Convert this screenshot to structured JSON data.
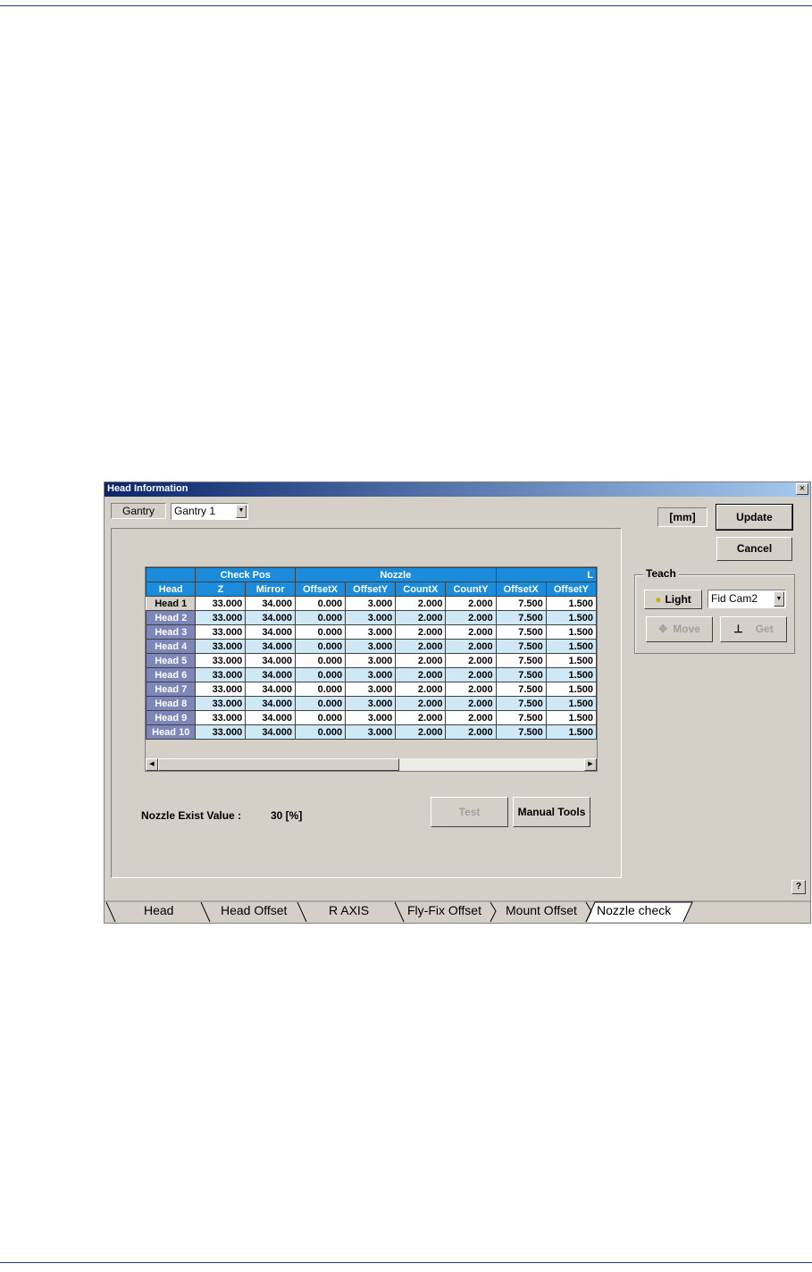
{
  "dialog": {
    "title": "Head Information",
    "close_glyph": "×",
    "gantry_label": "Gantry",
    "gantry_value": "Gantry 1",
    "unit": "[mm]",
    "update_label": "Update",
    "cancel_label": "Cancel",
    "help_glyph": "?"
  },
  "teach": {
    "legend": "Teach",
    "light_label": "Light",
    "camera_value": "Fid Cam2",
    "move_label": "Move",
    "get_label": "Get"
  },
  "grid": {
    "group_headers": [
      "Check Pos",
      "Nozzle",
      "L"
    ],
    "columns": [
      "Head",
      "Z",
      "Mirror",
      "OffsetX",
      "OffsetY",
      "CountX",
      "CountY",
      "OffsetX",
      "OffsetY"
    ],
    "rows": [
      {
        "head": "Head 1",
        "cells": [
          "33.000",
          "34.000",
          "0.000",
          "3.000",
          "2.000",
          "2.000",
          "7.500",
          "1.500"
        ]
      },
      {
        "head": "Head 2",
        "cells": [
          "33.000",
          "34.000",
          "0.000",
          "3.000",
          "2.000",
          "2.000",
          "7.500",
          "1.500"
        ]
      },
      {
        "head": "Head 3",
        "cells": [
          "33.000",
          "34.000",
          "0.000",
          "3.000",
          "2.000",
          "2.000",
          "7.500",
          "1.500"
        ]
      },
      {
        "head": "Head 4",
        "cells": [
          "33.000",
          "34.000",
          "0.000",
          "3.000",
          "2.000",
          "2.000",
          "7.500",
          "1.500"
        ]
      },
      {
        "head": "Head 5",
        "cells": [
          "33.000",
          "34.000",
          "0.000",
          "3.000",
          "2.000",
          "2.000",
          "7.500",
          "1.500"
        ]
      },
      {
        "head": "Head 6",
        "cells": [
          "33.000",
          "34.000",
          "0.000",
          "3.000",
          "2.000",
          "2.000",
          "7.500",
          "1.500"
        ]
      },
      {
        "head": "Head 7",
        "cells": [
          "33.000",
          "34.000",
          "0.000",
          "3.000",
          "2.000",
          "2.000",
          "7.500",
          "1.500"
        ]
      },
      {
        "head": "Head 8",
        "cells": [
          "33.000",
          "34.000",
          "0.000",
          "3.000",
          "2.000",
          "2.000",
          "7.500",
          "1.500"
        ]
      },
      {
        "head": "Head 9",
        "cells": [
          "33.000",
          "34.000",
          "0.000",
          "3.000",
          "2.000",
          "2.000",
          "7.500",
          "1.500"
        ]
      },
      {
        "head": "Head 10",
        "cells": [
          "33.000",
          "34.000",
          "0.000",
          "3.000",
          "2.000",
          "2.000",
          "7.500",
          "1.500"
        ]
      }
    ]
  },
  "nozzle": {
    "exist_label": "Nozzle Exist Value :",
    "exist_value": "30 [%]",
    "test_label": "Test",
    "manual_tools_label": "Manual Tools"
  },
  "tabs": [
    "Head",
    "Head Offset",
    "R AXIS",
    "Fly-Fix Offset",
    "Mount Offset",
    "Nozzle check"
  ],
  "active_tab": "Nozzle check",
  "colors": {
    "header_blue": "#1b8cdb",
    "row_header": "#7c86b8",
    "alt_row": "#cfe8f5",
    "titlebar_start": "#0a246a",
    "titlebar_end": "#a6caf0"
  }
}
